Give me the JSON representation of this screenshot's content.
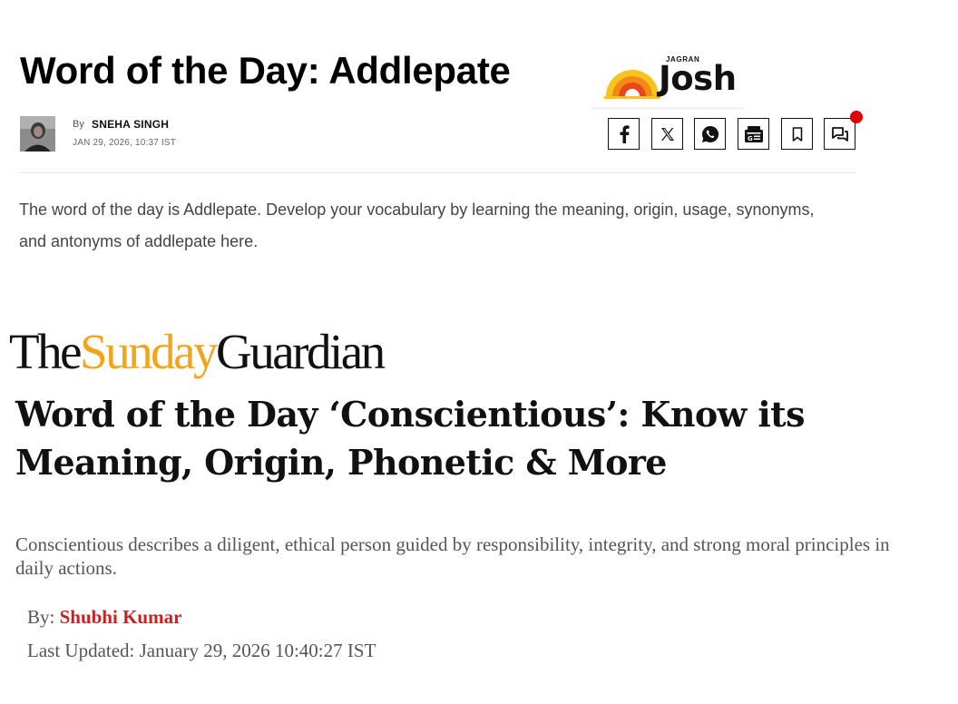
{
  "jagran_josh": {
    "title": "Word of the Day: Addlepate",
    "logo": {
      "small_text": "JAGRAN",
      "brand_text": "Josh",
      "sun_colors": [
        "#f7c31c",
        "#f28a1a",
        "#e8471e"
      ]
    },
    "byline": {
      "by_label": "By",
      "author": "SNEHA SINGH",
      "date": "JAN 29, 2026, 10:37 IST"
    },
    "share_buttons": [
      {
        "icon": "facebook-icon"
      },
      {
        "icon": "x-icon"
      },
      {
        "icon": "whatsapp-icon"
      },
      {
        "icon": "google-news-icon"
      },
      {
        "icon": "bookmark-icon"
      },
      {
        "icon": "comments-icon"
      }
    ],
    "notification_color": "#e00000",
    "summary": "The word of the day is Addlepate. Develop your vocabulary by learning the meaning, origin, usage, synonyms, and antonyms of addlepate here."
  },
  "sunday_guardian": {
    "logo": {
      "part1": "The",
      "part2": "Sunday",
      "part3": "Guardian",
      "accent_color": "#f2a51a"
    },
    "headline": "Word of the Day ‘Conscientious’: Know its Meaning, Origin, Phonetic & More",
    "summary": "Conscientious describes a diligent, ethical person guided by responsibility, integrity, and strong moral principles in daily actions.",
    "byline": {
      "by_label": "By:",
      "author": "Shubhi Kumar",
      "author_color": "#cc1f1f"
    },
    "updated": "Last Updated: January 29, 2026 10:40:27 IST"
  }
}
